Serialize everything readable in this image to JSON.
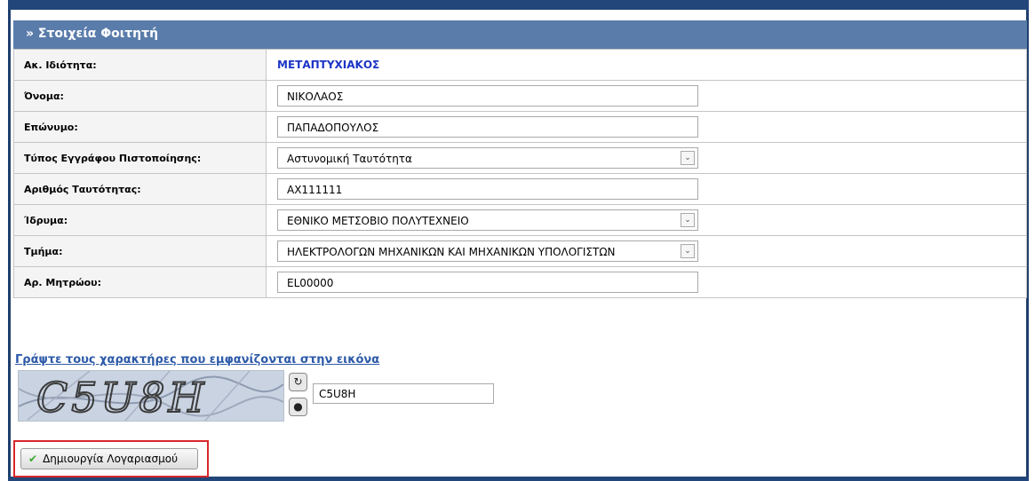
{
  "panel": {
    "title": "» Στοιχεία Φοιτητή"
  },
  "form": {
    "ak_label": "Ακ. Ιδιότητα:",
    "ak_value": "ΜΕΤΑΠΤΥΧΙΑΚΟΣ",
    "first_name_label": "Όνομα:",
    "first_name_value": "ΝΙΚΟΛΑΟΣ",
    "last_name_label": "Επώνυμο:",
    "last_name_value": "ΠΑΠΑΔΟΠΟΥΛΟΣ",
    "doc_type_label": "Τύπος Εγγράφου Πιστοποίησης:",
    "doc_type_value": "Αστυνομική Ταυτότητα",
    "id_number_label": "Αριθμός Ταυτότητας:",
    "id_number_value": "ΑΧ111111",
    "institution_label": "Ίδρυμα:",
    "institution_value": "ΕΘΝΙΚΟ ΜΕΤΣΟΒΙΟ ΠΟΛΥΤΕΧΝΕΙΟ",
    "department_label": "Τμήμα:",
    "department_value": "ΗΛΕΚΤΡΟΛΟΓΩΝ ΜΗΧΑΝΙΚΩΝ ΚΑΙ ΜΗΧΑΝΙΚΩΝ ΥΠΟΛΟΓΙΣΤΩΝ",
    "registry_label": "Αρ. Μητρώου:",
    "registry_value": "EL00000"
  },
  "captcha": {
    "instruction": "Γράψτε τους χαρακτήρες που εμφανίζονται στην εικόνα",
    "image_text": "C5U8H",
    "input_value": "C5U8H",
    "refresh_icon": "refresh-icon",
    "audio_icon": "audio-icon"
  },
  "actions": {
    "create_label": "Δημιουργία Λογαριασμού",
    "create_icon": "checkmark-icon"
  },
  "colors": {
    "header_bg": "#5a7cab",
    "frame": "#22467a",
    "highlight_border": "#d7282b",
    "value_blue": "#1c35c6"
  }
}
